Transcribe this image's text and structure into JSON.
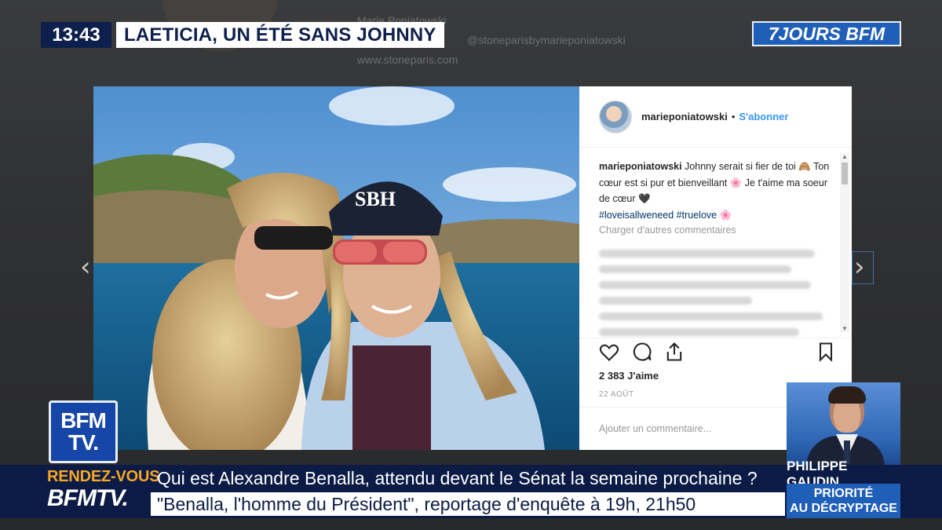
{
  "broadcast": {
    "time": "13:43",
    "headline": "LAETICIA, UN ÉTÉ SANS JOHNNY",
    "channel_logo": "7JOURS BFM"
  },
  "background_page": {
    "name": "Marie Poniatowski",
    "handle": "@stoneparisbymarieponiatowski",
    "website": "www.stoneparis.com"
  },
  "instagram": {
    "username": "marieponiatowski",
    "follow_label": "S'abonner",
    "caption_author": "marieponiatowski",
    "caption_text": "Johnny serait si fier de toi 🙈 Ton cœur est si pur et bienveillant 🌸 Je t'aime ma soeur de cœur 🖤",
    "hashtags": "#loveisallweneed #truelove 🌸",
    "load_more": "Charger d'autres commentaires",
    "likes": "2 383 J'aime",
    "date": "22 AOÛT",
    "add_comment_placeholder": "Ajouter un commentaire...",
    "photo_cap_text": "SBH"
  },
  "lower_third": {
    "rdv_label": "RENDEZ-VOUS",
    "rdv_brand": "BFMTV.",
    "line1": "Qui est Alexandre Benalla, attendu devant le Sénat la semaine prochaine ?",
    "line2": "\"Benalla, l'homme du Président\", reportage d'enquête à 19h, 21h50",
    "presenter_name": "PHILIPPE GAUDIN",
    "presenter_show_1": "PRIORITÉ",
    "presenter_show_2": "AU DÉCRYPTAGE"
  },
  "channel_badge": {
    "line1": "BFM",
    "line2": "TV."
  },
  "colors": {
    "navy": "#0b1b45",
    "bfm_blue": "#1f5fb8",
    "rdv_orange": "#f7a823",
    "ig_link": "#3897f0"
  }
}
